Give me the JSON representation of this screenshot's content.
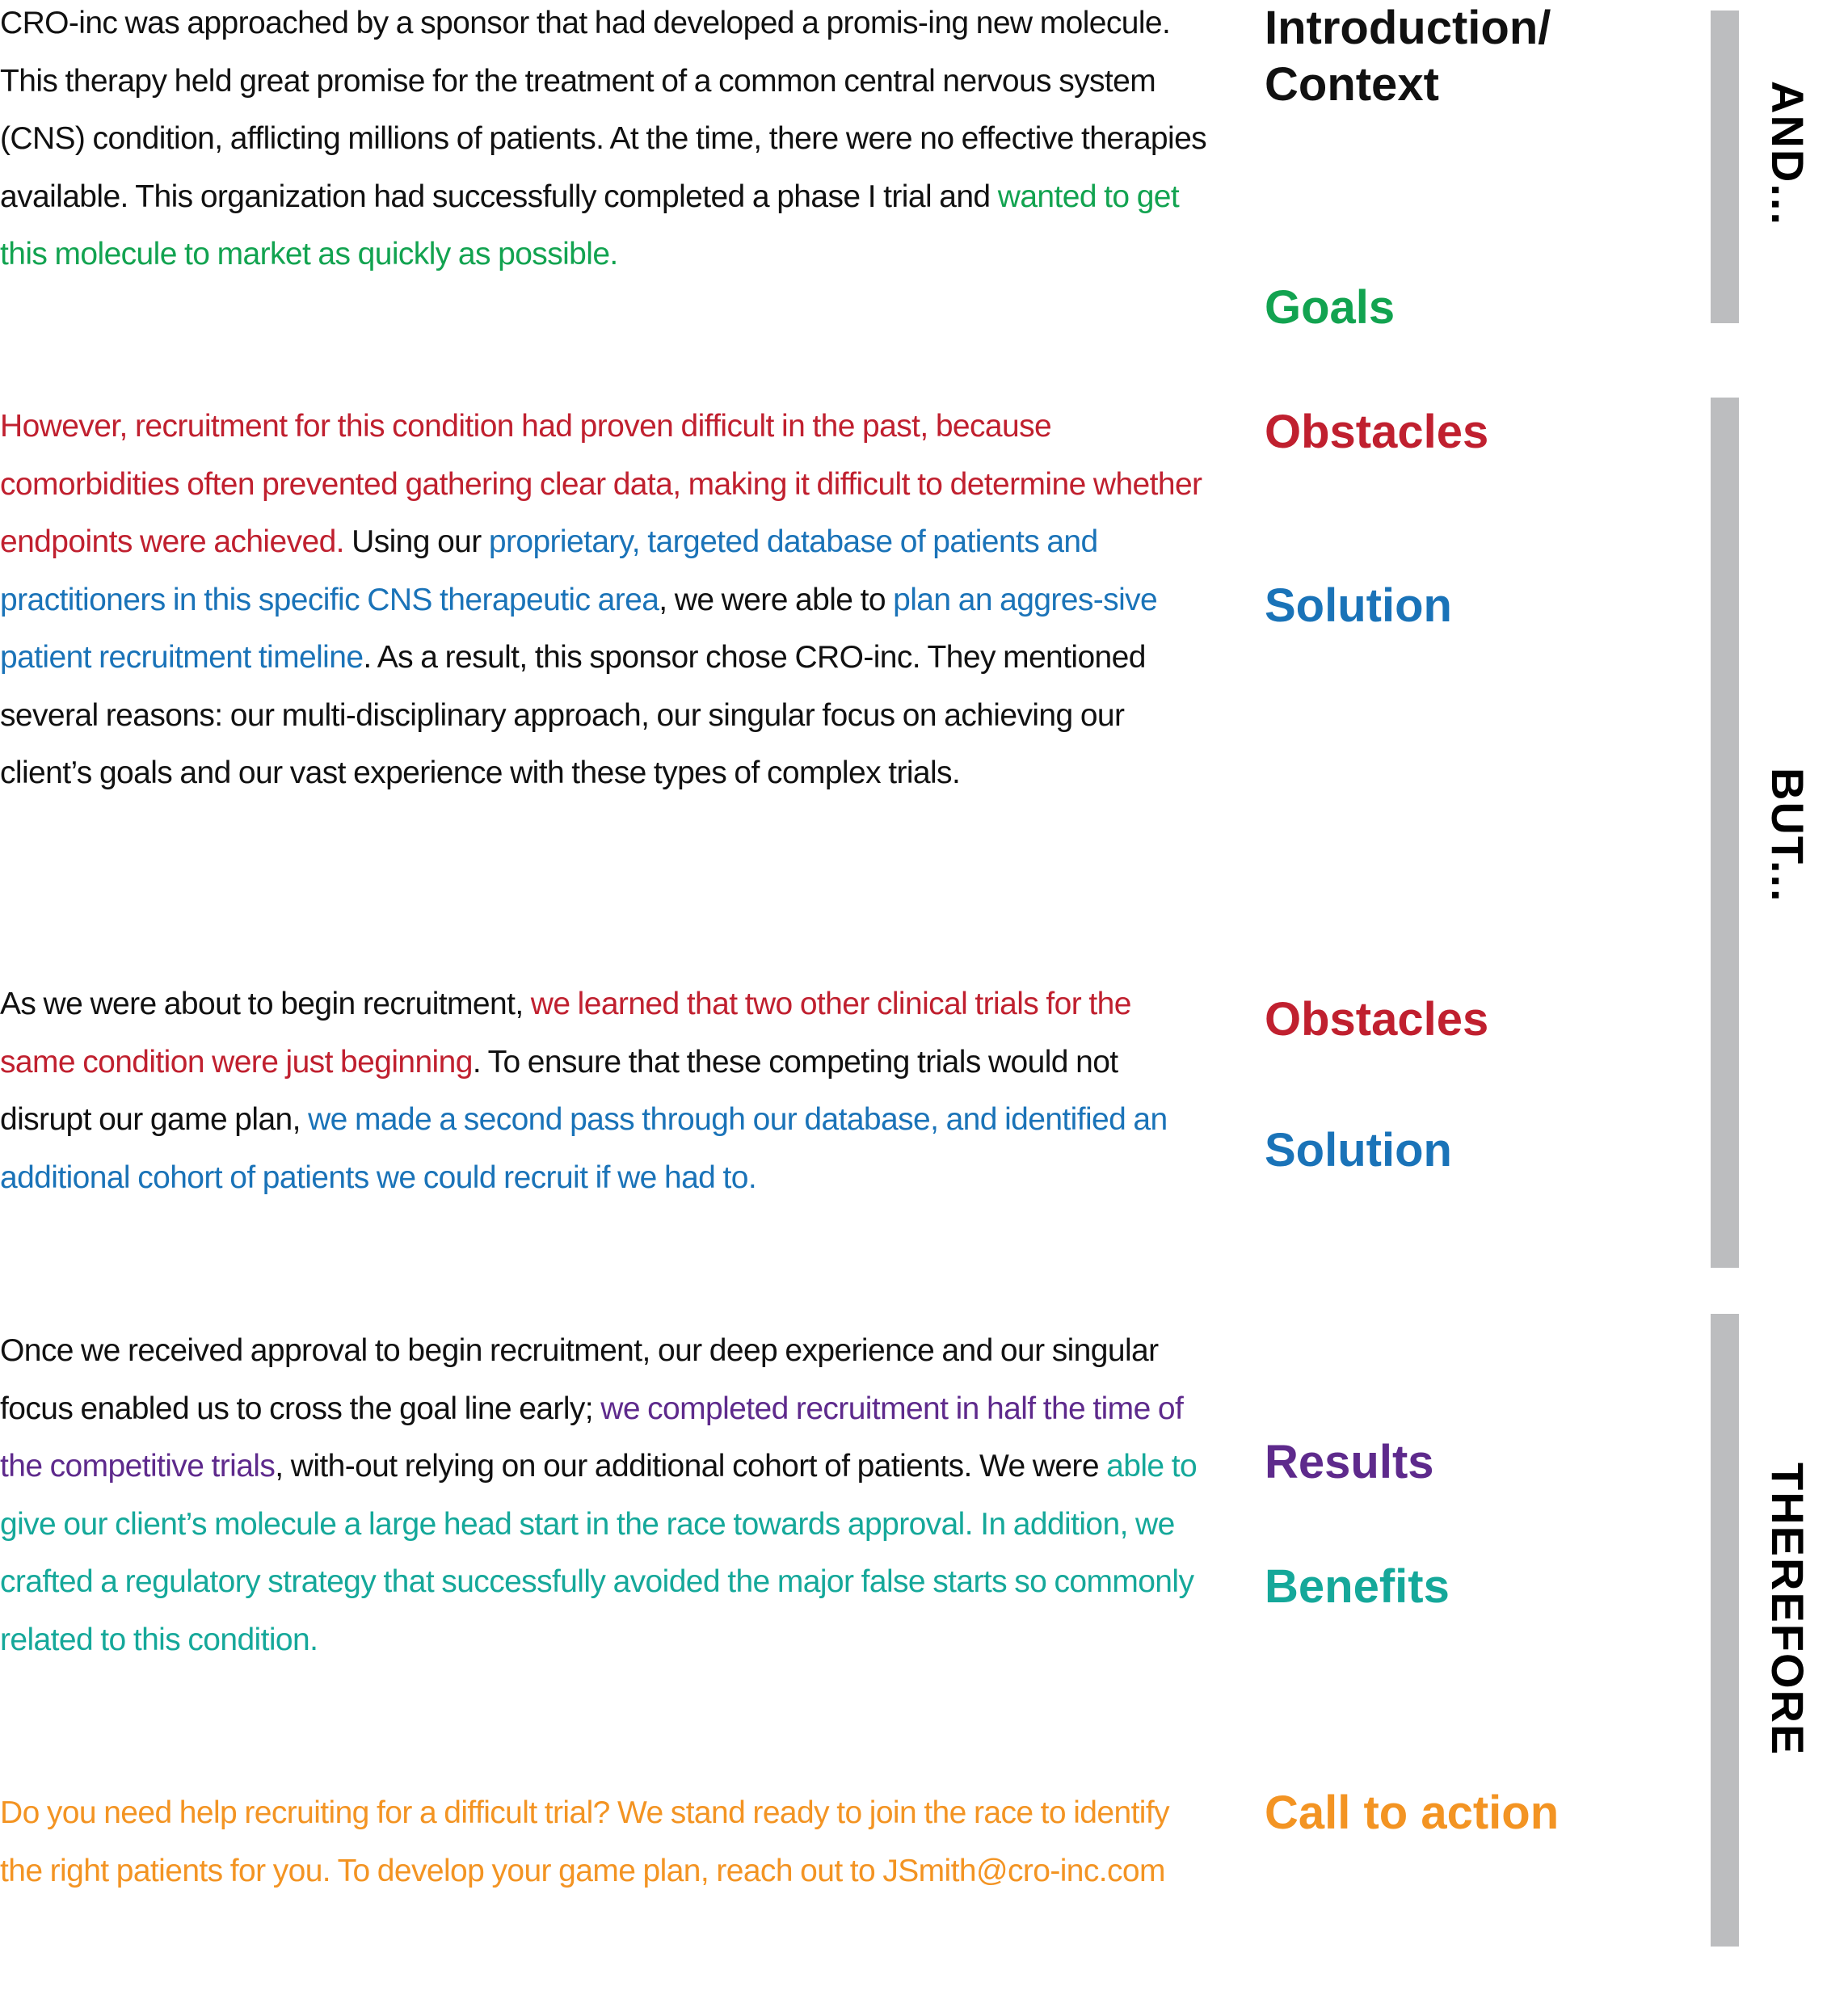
{
  "colors": {
    "body_text": "#111111",
    "goals": "#12a350",
    "obstacles": "#c0202f",
    "solution": "#1a73b8",
    "results": "#5e2a8c",
    "benefits": "#15a89a",
    "call_to_action": "#f39423",
    "bar": "#bcbdbf"
  },
  "paragraphs": [
    {
      "segments": [
        {
          "text": "CRO-inc was approached by a sponsor that had developed a promis-ing new molecule. This therapy held great promise for the treatment of a common central nervous system (CNS) condition, afflicting millions of patients. At the time, there were no effective therapies available. This organization had successfully completed a phase I trial and ",
          "role": "context"
        },
        {
          "text": "wanted to get this molecule to market as quickly as possible.",
          "role": "goals"
        }
      ]
    },
    {
      "segments": [
        {
          "text": "However, recruitment for this condition had proven difficult in the past, because comorbidities often prevented gathering clear data, making it difficult to determine whether endpoints were achieved.",
          "role": "obstacles"
        },
        {
          "text": " Using our ",
          "role": "context"
        },
        {
          "text": "proprietary, targeted database of patients and practitioners in this specific CNS therapeutic area",
          "role": "solution"
        },
        {
          "text": ", we were able to ",
          "role": "context"
        },
        {
          "text": "plan an aggres-sive patient recruitment timeline",
          "role": "solution"
        },
        {
          "text": ". As a result, this sponsor chose CRO-inc. They mentioned several reasons: our multi-disciplinary approach, our singular focus on achieving our client’s goals and our vast experience with these types of complex trials.",
          "role": "context"
        }
      ]
    },
    {
      "segments": [
        {
          "text": "As we were about to begin recruitment, ",
          "role": "context"
        },
        {
          "text": "we learned that two other clinical trials for the same condition were just beginning",
          "role": "obstacles"
        },
        {
          "text": ". To ensure that these competing trials would not disrupt our game plan, ",
          "role": "context"
        },
        {
          "text": "we made a second pass through our database, and identified an additional cohort of patients we could recruit if we had to.",
          "role": "solution"
        }
      ]
    },
    {
      "segments": [
        {
          "text": "Once we received approval to begin recruitment, our deep experience and our singular focus enabled us to cross the goal line early; ",
          "role": "context"
        },
        {
          "text": "we completed recruitment in half the time of the competitive trials",
          "role": "results"
        },
        {
          "text": ", with-out relying on our additional cohort of patients. We were ",
          "role": "context"
        },
        {
          "text": "able to give our client’s molecule a large head start in the race towards approval. In addition, we crafted a regulatory strategy that successfully avoided the major false starts so commonly related to this condition.",
          "role": "benefits"
        }
      ]
    },
    {
      "segments": [
        {
          "text": "Do you need help recruiting for a difficult trial? We stand ready to join the race to identify the right patients for you. To develop your game plan, reach out to JSmith@cro-inc.com",
          "role": "call_to_action"
        }
      ]
    }
  ],
  "labels": [
    {
      "text": "Introduction/ Context",
      "role": "context"
    },
    {
      "text": "Goals",
      "role": "goals"
    },
    {
      "text": "Obstacles",
      "role": "obstacles"
    },
    {
      "text": "Solution",
      "role": "solution"
    },
    {
      "text": "Obstacles",
      "role": "obstacles"
    },
    {
      "text": "Solution",
      "role": "solution"
    },
    {
      "text": "Results",
      "role": "results"
    },
    {
      "text": "Benefits",
      "role": "benefits"
    },
    {
      "text": "Call to action",
      "role": "call_to_action"
    }
  ],
  "sections": [
    {
      "label": "AND..."
    },
    {
      "label": "BUT..."
    },
    {
      "label": "THEREFORE"
    }
  ]
}
